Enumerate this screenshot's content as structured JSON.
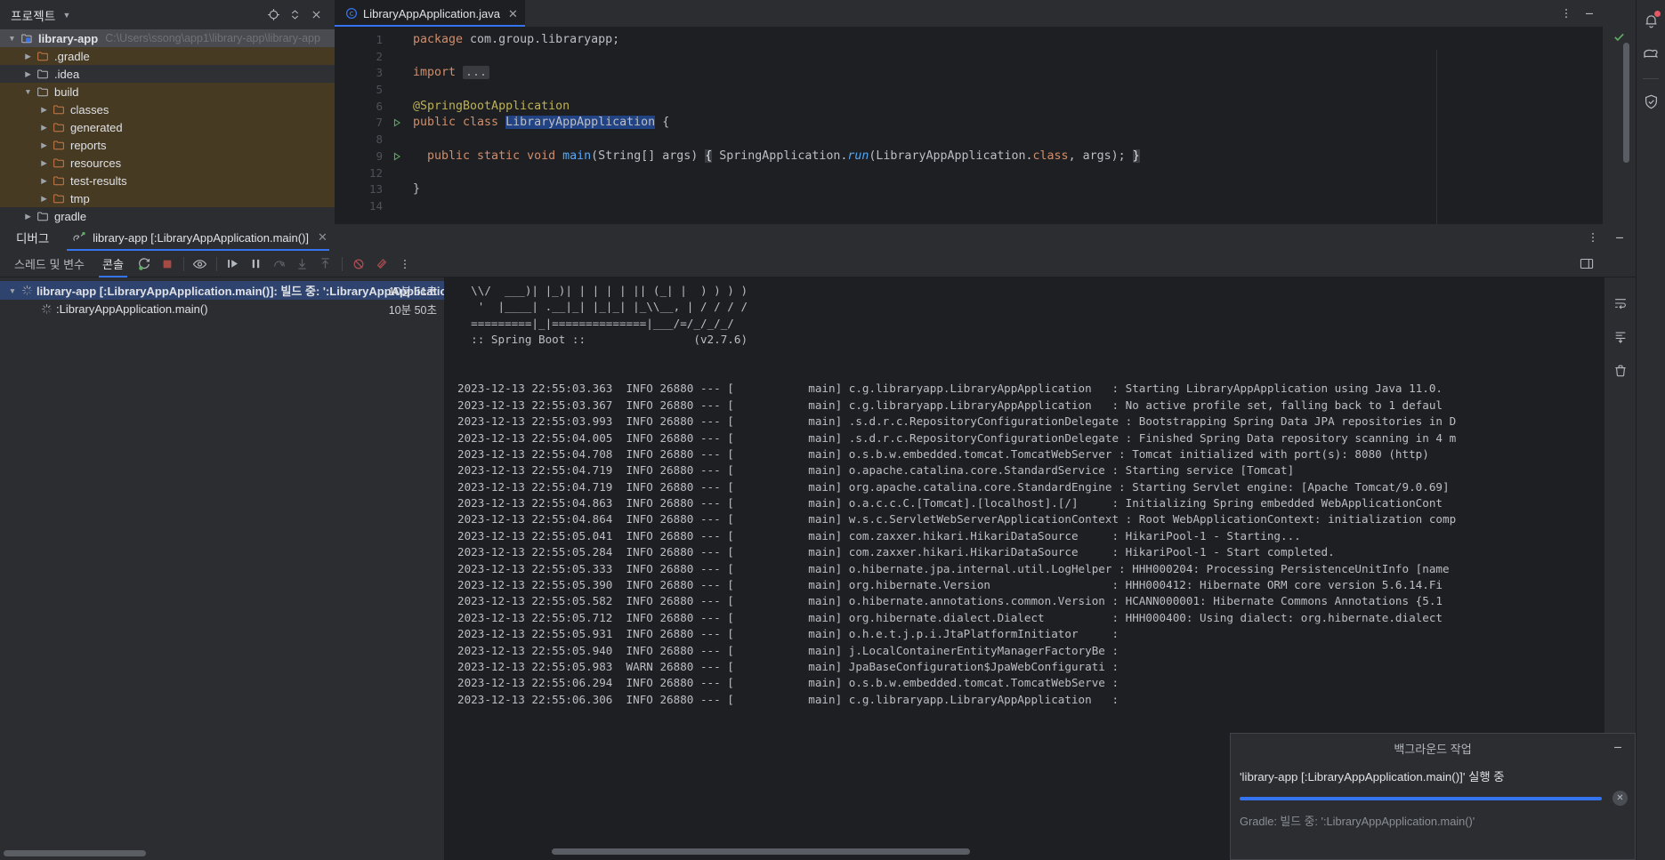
{
  "project_panel": {
    "title": "프로젝트",
    "chevron_icon": "chevron-down-icon",
    "header_icons": [
      "locate-icon",
      "expand-collapse-icon",
      "close-icon"
    ],
    "tree": [
      {
        "label": "library-app",
        "path": "C:\\Users\\ssong\\app1\\library-app\\library-app",
        "indent": 0,
        "expanded": true,
        "selected": true,
        "icon": "module-icon",
        "bold": true
      },
      {
        "label": ".gradle",
        "indent": 1,
        "expanded": false,
        "icon": "folder-orange-icon",
        "highlight": "excluded"
      },
      {
        "label": ".idea",
        "indent": 1,
        "expanded": false,
        "icon": "folder-icon",
        "highlight": "hover"
      },
      {
        "label": "build",
        "indent": 1,
        "expanded": true,
        "icon": "folder-icon",
        "highlight": "excluded"
      },
      {
        "label": "classes",
        "indent": 2,
        "expanded": false,
        "icon": "folder-orange-icon",
        "highlight": "excluded"
      },
      {
        "label": "generated",
        "indent": 2,
        "expanded": false,
        "icon": "folder-orange-icon",
        "highlight": "excluded"
      },
      {
        "label": "reports",
        "indent": 2,
        "expanded": false,
        "icon": "folder-orange-icon",
        "highlight": "excluded"
      },
      {
        "label": "resources",
        "indent": 2,
        "expanded": false,
        "icon": "folder-orange-icon",
        "highlight": "excluded"
      },
      {
        "label": "test-results",
        "indent": 2,
        "expanded": false,
        "icon": "folder-orange-icon",
        "highlight": "excluded"
      },
      {
        "label": "tmp",
        "indent": 2,
        "expanded": false,
        "icon": "folder-orange-icon",
        "highlight": "excluded"
      },
      {
        "label": "gradle",
        "indent": 1,
        "expanded": false,
        "icon": "folder-icon"
      }
    ]
  },
  "editor": {
    "tab": {
      "label": "LibraryAppApplication.java",
      "icon": "java-class-icon",
      "close_icon": "close-icon"
    },
    "tabbar_icons": [
      "more-vertical-icon",
      "minimize-icon"
    ],
    "gutter_lines": [
      "1",
      "2",
      "3",
      "5",
      "6",
      "7",
      "8",
      "9",
      "12",
      "13",
      "14"
    ],
    "code_lines": [
      {
        "no": "1",
        "tokens": [
          {
            "t": "package ",
            "c": "kw"
          },
          {
            "t": "com.group.libraryapp;",
            "c": "pl"
          }
        ]
      },
      {
        "no": "2",
        "tokens": []
      },
      {
        "no": "3",
        "fold": true,
        "tokens": [
          {
            "t": "import ",
            "c": "kw"
          },
          {
            "t": "...",
            "c": "fold"
          }
        ]
      },
      {
        "no": "5",
        "tokens": []
      },
      {
        "no": "6",
        "tokens": [
          {
            "t": "@SpringBootApplication",
            "c": "ann"
          }
        ]
      },
      {
        "no": "7",
        "run": true,
        "tokens": [
          {
            "t": "public class ",
            "c": "kw"
          },
          {
            "t": "LibraryAppApplication",
            "c": "selident"
          },
          {
            "t": " {",
            "c": "pl"
          }
        ]
      },
      {
        "no": "8",
        "tokens": []
      },
      {
        "no": "9",
        "run": true,
        "fold": true,
        "tokens": [
          {
            "t": "  public static void ",
            "c": "kw"
          },
          {
            "t": "main",
            "c": "fn"
          },
          {
            "t": "(String[] args) ",
            "c": "pl"
          },
          {
            "t": "{",
            "c": "brace"
          },
          {
            "t": " SpringApplication.",
            "c": "pl"
          },
          {
            "t": "run",
            "c": "ital"
          },
          {
            "t": "(LibraryAppApplication.",
            "c": "pl"
          },
          {
            "t": "class",
            "c": "kw"
          },
          {
            "t": ", args); ",
            "c": "pl"
          },
          {
            "t": "}",
            "c": "brace"
          }
        ]
      },
      {
        "no": "12",
        "tokens": []
      },
      {
        "no": "13",
        "tokens": [
          {
            "t": "}",
            "c": "pl"
          }
        ]
      },
      {
        "no": "14",
        "tokens": []
      }
    ],
    "inspection_status_icon": "check-ok-icon"
  },
  "right_rail": {
    "icons": [
      "notifications-bell-icon",
      "database-icon",
      "security-shield-icon"
    ],
    "notification_badge": true
  },
  "debug_window": {
    "title": "디버그",
    "tab": {
      "label": "library-app [:LibraryAppApplication.main()]",
      "icon": "debug-run-icon",
      "close_icon": "close-icon"
    },
    "header_icons": [
      "more-vertical-icon",
      "minimize-icon"
    ],
    "toolbar": {
      "tabs": [
        {
          "label": "스레드 및 변수",
          "active": false
        },
        {
          "label": "콘솔",
          "active": true
        }
      ],
      "buttons": [
        {
          "name": "rerun-icon",
          "dim": false
        },
        {
          "name": "stop-icon",
          "dim": false
        },
        {
          "name": "view-breakpoints-icon",
          "dim": false
        },
        {
          "name": "resume-program-icon",
          "dim": false
        },
        {
          "name": "pause-program-icon",
          "dim": false
        },
        {
          "name": "step-over-icon",
          "dim": true
        },
        {
          "name": "step-into-icon",
          "dim": true
        },
        {
          "name": "step-out-icon",
          "dim": true
        },
        {
          "name": "mute-breakpoints-icon",
          "dim": false
        },
        {
          "name": "disable-breakpoints-icon",
          "dim": false
        },
        {
          "name": "more-vertical-icon",
          "dim": false
        }
      ],
      "right_icon": "layout-settings-icon"
    },
    "frames": [
      {
        "label": "library-app [:LibraryAppApplication.main()]: 빌드 중: ':LibraryAppApplication.ma",
        "time": "10분 51초",
        "indent": 0,
        "selected": true,
        "bold": true,
        "expanded": true,
        "icon": "spinner-icon"
      },
      {
        "label": ":LibraryAppApplication.main()",
        "time": "10분 50초",
        "indent": 1,
        "selected": false,
        "bold": false,
        "icon": "spinner-icon"
      }
    ],
    "console_side_icons": [
      "soft-wrap-icon",
      "scroll-to-end-icon",
      "clear-all-icon"
    ],
    "console": {
      "banner": [
        "  \\\\/  ___)| |_)| | | | | || (_| |  ) ) ) )",
        "   '  |____| .__|_| |_|_| |_\\\\__, | / / / /",
        "  =========|_|==============|___/=/_/_/_/",
        "  :: Spring Boot ::                (v2.7.6)"
      ],
      "log_lines": [
        {
          "ts": "2023-12-13 22:55:03.363",
          "level": "INFO",
          "pid": "26880",
          "thread": "main",
          "logger": "c.g.libraryapp.LibraryAppApplication",
          "msg": "Starting LibraryAppApplication using Java 11.0."
        },
        {
          "ts": "2023-12-13 22:55:03.367",
          "level": "INFO",
          "pid": "26880",
          "thread": "main",
          "logger": "c.g.libraryapp.LibraryAppApplication",
          "msg": "No active profile set, falling back to 1 defaul"
        },
        {
          "ts": "2023-12-13 22:55:03.993",
          "level": "INFO",
          "pid": "26880",
          "thread": "main",
          "logger": ".s.d.r.c.RepositoryConfigurationDelegate",
          "msg": "Bootstrapping Spring Data JPA repositories in D"
        },
        {
          "ts": "2023-12-13 22:55:04.005",
          "level": "INFO",
          "pid": "26880",
          "thread": "main",
          "logger": ".s.d.r.c.RepositoryConfigurationDelegate",
          "msg": "Finished Spring Data repository scanning in 4 m"
        },
        {
          "ts": "2023-12-13 22:55:04.708",
          "level": "INFO",
          "pid": "26880",
          "thread": "main",
          "logger": "o.s.b.w.embedded.tomcat.TomcatWebServer",
          "msg": "Tomcat initialized with port(s): 8080 (http)"
        },
        {
          "ts": "2023-12-13 22:55:04.719",
          "level": "INFO",
          "pid": "26880",
          "thread": "main",
          "logger": "o.apache.catalina.core.StandardService",
          "msg": "Starting service [Tomcat]"
        },
        {
          "ts": "2023-12-13 22:55:04.719",
          "level": "INFO",
          "pid": "26880",
          "thread": "main",
          "logger": "org.apache.catalina.core.StandardEngine",
          "msg": "Starting Servlet engine: [Apache Tomcat/9.0.69]"
        },
        {
          "ts": "2023-12-13 22:55:04.863",
          "level": "INFO",
          "pid": "26880",
          "thread": "main",
          "logger": "o.a.c.c.C.[Tomcat].[localhost].[/]",
          "msg": "Initializing Spring embedded WebApplicationCont"
        },
        {
          "ts": "2023-12-13 22:55:04.864",
          "level": "INFO",
          "pid": "26880",
          "thread": "main",
          "logger": "w.s.c.ServletWebServerApplicationContext",
          "msg": "Root WebApplicationContext: initialization comp"
        },
        {
          "ts": "2023-12-13 22:55:05.041",
          "level": "INFO",
          "pid": "26880",
          "thread": "main",
          "logger": "com.zaxxer.hikari.HikariDataSource",
          "msg": "HikariPool-1 - Starting..."
        },
        {
          "ts": "2023-12-13 22:55:05.284",
          "level": "INFO",
          "pid": "26880",
          "thread": "main",
          "logger": "com.zaxxer.hikari.HikariDataSource",
          "msg": "HikariPool-1 - Start completed."
        },
        {
          "ts": "2023-12-13 22:55:05.333",
          "level": "INFO",
          "pid": "26880",
          "thread": "main",
          "logger": "o.hibernate.jpa.internal.util.LogHelper",
          "msg": "HHH000204: Processing PersistenceUnitInfo [name"
        },
        {
          "ts": "2023-12-13 22:55:05.390",
          "level": "INFO",
          "pid": "26880",
          "thread": "main",
          "logger": "org.hibernate.Version",
          "msg": "HHH000412: Hibernate ORM core version 5.6.14.Fi"
        },
        {
          "ts": "2023-12-13 22:55:05.582",
          "level": "INFO",
          "pid": "26880",
          "thread": "main",
          "logger": "o.hibernate.annotations.common.Version",
          "msg": "HCANN000001: Hibernate Commons Annotations {5.1"
        },
        {
          "ts": "2023-12-13 22:55:05.712",
          "level": "INFO",
          "pid": "26880",
          "thread": "main",
          "logger": "org.hibernate.dialect.Dialect",
          "msg": "HHH000400: Using dialect: org.hibernate.dialect"
        },
        {
          "ts": "2023-12-13 22:55:05.931",
          "level": "INFO",
          "pid": "26880",
          "thread": "main",
          "logger": "o.h.e.t.j.p.i.JtaPlatformInitiator",
          "msg": ""
        },
        {
          "ts": "2023-12-13 22:55:05.940",
          "level": "INFO",
          "pid": "26880",
          "thread": "main",
          "logger": "j.LocalContainerEntityManagerFactoryBe",
          "msg": ""
        },
        {
          "ts": "2023-12-13 22:55:05.983",
          "level": "WARN",
          "pid": "26880",
          "thread": "main",
          "logger": "JpaBaseConfiguration$JpaWebConfigurati",
          "msg": ""
        },
        {
          "ts": "2023-12-13 22:55:06.294",
          "level": "INFO",
          "pid": "26880",
          "thread": "main",
          "logger": "o.s.b.w.embedded.tomcat.TomcatWebServe",
          "msg": ""
        },
        {
          "ts": "2023-12-13 22:55:06.306",
          "level": "INFO",
          "pid": "26880",
          "thread": "main",
          "logger": "c.g.libraryapp.LibraryAppApplication",
          "msg": ""
        }
      ]
    }
  },
  "background_popup": {
    "title": "백그라운드 작업",
    "minimize_icon": "minimize-icon",
    "task_name": "'library-app [:LibraryAppApplication.main()]' 실행 중",
    "progress_percent": 100,
    "subtask": "Gradle: 빌드 중: ':LibraryAppApplication.main()'",
    "cancel_icon": "cancel-icon"
  },
  "colors": {
    "accent": "#3574f0",
    "bg": "#2b2d30",
    "editor_bg": "#1e1f22",
    "selection": "#2e436e",
    "excluded": "#473a23",
    "keyword": "#cf8e6d",
    "annotation": "#bcb153",
    "method": "#56a8f5",
    "ok": "#5fad65",
    "error": "#e55765"
  }
}
